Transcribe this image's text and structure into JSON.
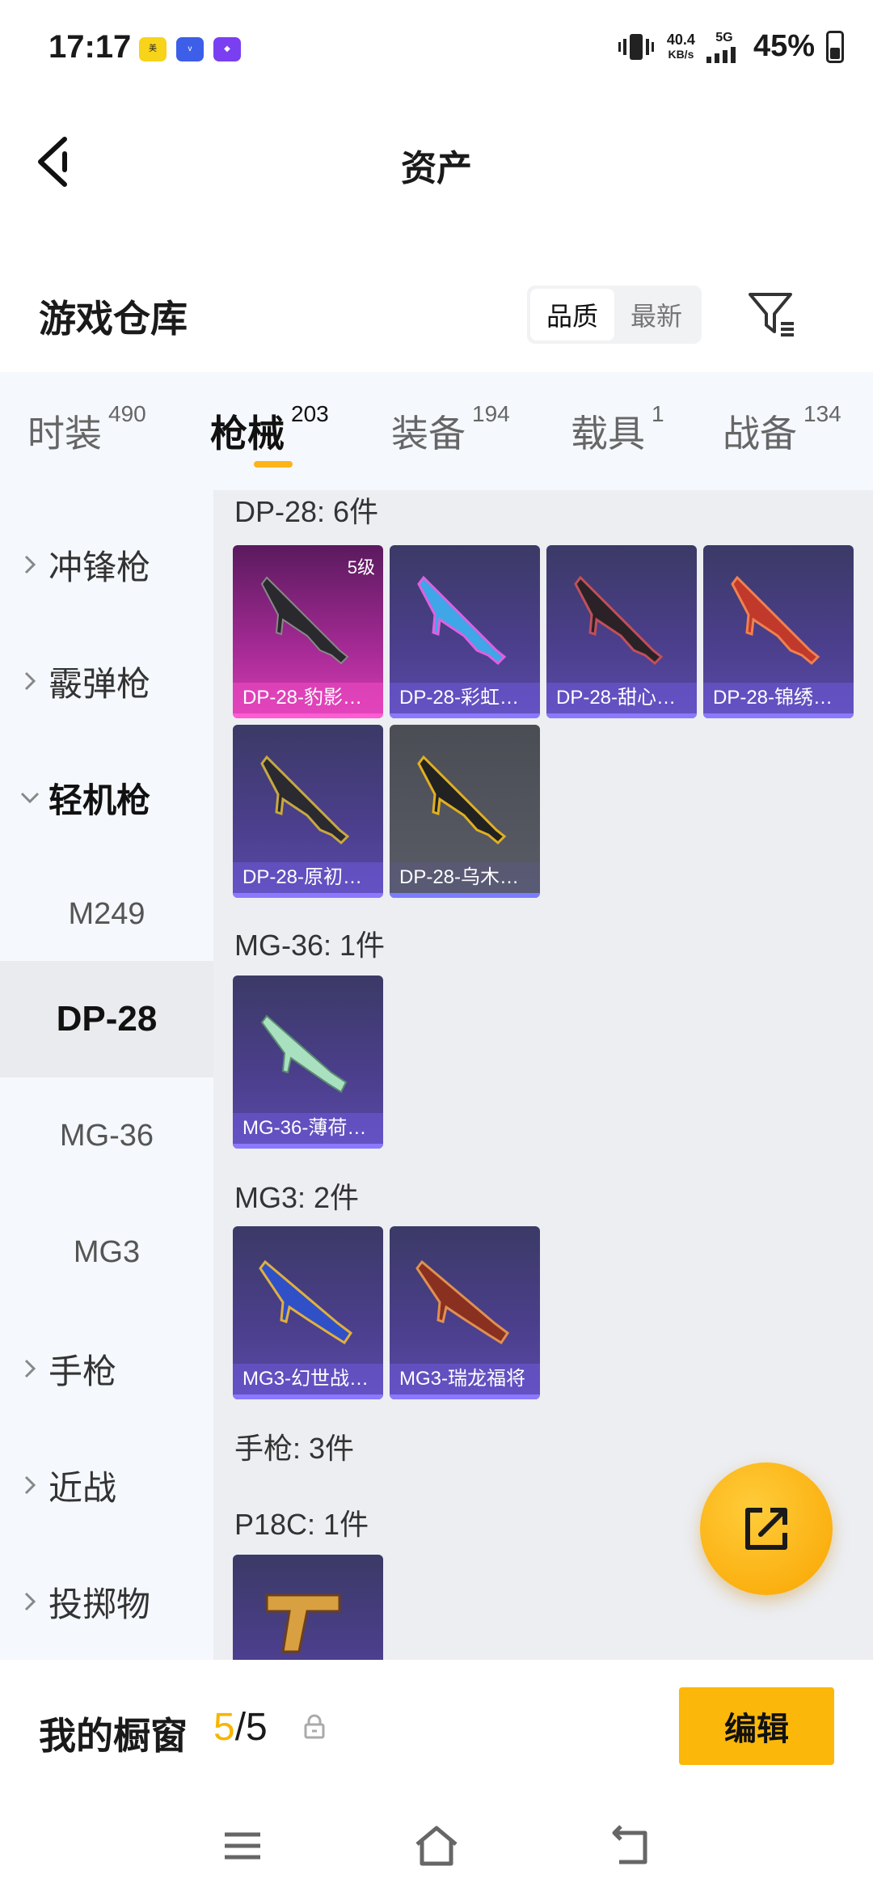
{
  "status_bar": {
    "time": "17:17",
    "speed_value": "40.4",
    "speed_unit": "KB/s",
    "network": "5G",
    "battery_percent": "45%",
    "battery_level": 0.45,
    "app_icons": [
      "meituan-icon",
      "vivo-icon",
      "assistant-icon"
    ]
  },
  "header": {
    "title": "资产",
    "back_icon": "back-arrow-icon"
  },
  "section": {
    "title": "游戏仓库",
    "sort_options": [
      "品质",
      "最新"
    ],
    "sort_selected": "品质",
    "filter_icon": "filter-icon"
  },
  "tabs": [
    {
      "label": "时装",
      "count": "490"
    },
    {
      "label": "枪械",
      "count": "203"
    },
    {
      "label": "装备",
      "count": "194"
    },
    {
      "label": "载具",
      "count": "1"
    },
    {
      "label": "战备",
      "count": "134"
    }
  ],
  "active_tab": "枪械",
  "sidebar": {
    "categories": [
      {
        "label": "冲锋枪",
        "expanded": false
      },
      {
        "label": "霰弹枪",
        "expanded": false
      },
      {
        "label": "轻机枪",
        "expanded": true
      },
      {
        "label": "手枪",
        "expanded": false
      },
      {
        "label": "近战",
        "expanded": false
      },
      {
        "label": "投掷物",
        "expanded": false
      }
    ],
    "subitems": [
      "M249",
      "DP-28",
      "MG-36",
      "MG3"
    ],
    "active_subitem": "DP-28"
  },
  "content": {
    "groups": [
      {
        "title": "DP-28: 6件",
        "items": [
          {
            "name": "DP-28-豹影…",
            "level": "5级",
            "style": "gold"
          },
          {
            "name": "DP-28-彩虹…",
            "style": "purple"
          },
          {
            "name": "DP-28-甜心…",
            "style": "purple"
          },
          {
            "name": "DP-28-锦绣…",
            "style": "purple"
          },
          {
            "name": "DP-28-原初…",
            "style": "purple"
          },
          {
            "name": "DP-28-乌木…",
            "style": "gray"
          }
        ]
      },
      {
        "title": "MG-36: 1件",
        "items": [
          {
            "name": "MG-36-薄荷…",
            "style": "purple"
          }
        ]
      },
      {
        "title": "MG3: 2件",
        "items": [
          {
            "name": "MG3-幻世战…",
            "style": "purple"
          },
          {
            "name": "MG3-瑞龙福将",
            "style": "purple"
          }
        ]
      },
      {
        "title": "手枪: 3件",
        "items": []
      },
      {
        "title": "P18C: 1件",
        "items": [
          {
            "name": "",
            "style": "purple"
          }
        ]
      }
    ]
  },
  "fab_icon": "share-out-icon",
  "showcase": {
    "label": "我的橱窗",
    "current": "5",
    "separator": "/",
    "total": "5",
    "lock_icon": "lock-icon",
    "edit_label": "编辑"
  },
  "nav": {
    "icons": [
      "menu-icon",
      "home-icon",
      "back-icon"
    ]
  },
  "colors": {
    "accent": "#fbb70a",
    "tab_underline": "#fdb31a",
    "card_purple": "#4c3f8e",
    "card_pink": "#d83fb2",
    "card_gray": "#5a5c66"
  }
}
